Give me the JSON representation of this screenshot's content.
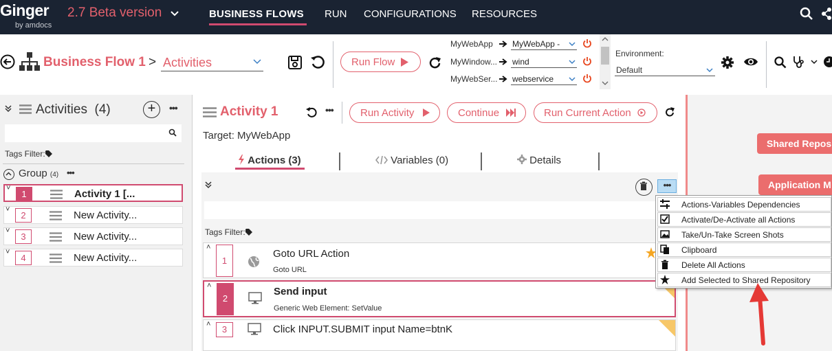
{
  "topnav": {
    "logo": "Ginger",
    "logo_sub": "by amdocs",
    "version": "2.7 Beta version",
    "links": [
      "BUSINESS FLOWS",
      "RUN",
      "CONFIGURATIONS",
      "RESOURCES"
    ]
  },
  "toolbar": {
    "title": "Business Flow 1",
    "separator": ">",
    "view_select": "Activities",
    "run_flow": "Run Flow",
    "agents": [
      {
        "name": "MyWebApp",
        "value": "MyWebApp -"
      },
      {
        "name": "MyWindow...",
        "value": "wind"
      },
      {
        "name": "MyWebSer...",
        "value": "webservice"
      }
    ],
    "environment_label": "Environment:",
    "environment_value": "Default"
  },
  "left_panel": {
    "title": "Activities",
    "count": "(4)",
    "search_placeholder": "",
    "tags_filter": "Tags Filter:",
    "group_label": "Group",
    "group_count": "(4)",
    "activities": [
      {
        "num": "1",
        "name": "Activity 1 [..."
      },
      {
        "num": "2",
        "name": "New Activity..."
      },
      {
        "num": "3",
        "name": "New Activity..."
      },
      {
        "num": "4",
        "name": "New Activity..."
      }
    ]
  },
  "center": {
    "title": "Activity 1",
    "run_activity": "Run Activity",
    "continue": "Continue",
    "run_current_action": "Run Current Action",
    "target": "Target: MyWebApp",
    "tabs": [
      "Actions (3)",
      "Variables (0)",
      "Details"
    ],
    "tags_filter": "Tags Filter:",
    "actions": [
      {
        "num": "1",
        "name": "Goto URL Action",
        "desc": "Goto URL"
      },
      {
        "num": "2",
        "name": "Send input",
        "desc": "Generic Web Element: SetValue"
      },
      {
        "num": "3",
        "name": "Click INPUT.SUBMIT input Name=btnK",
        "desc": ""
      }
    ]
  },
  "right_panel": {
    "buttons": [
      "Shared Repos",
      "Application M"
    ]
  },
  "context_menu": {
    "items": [
      "Actions-Variables Dependencies",
      "Activate/De-Activate all Actions",
      "Take/Un-Take Screen Shots",
      "Clipboard",
      "Delete All Actions",
      "Add Selected to Shared Repository"
    ]
  },
  "colors": {
    "accent": "#e2606c",
    "accent_dark": "#d04a6f",
    "nav_bg": "#1a2332",
    "annotation_arrow": "#e53935"
  }
}
